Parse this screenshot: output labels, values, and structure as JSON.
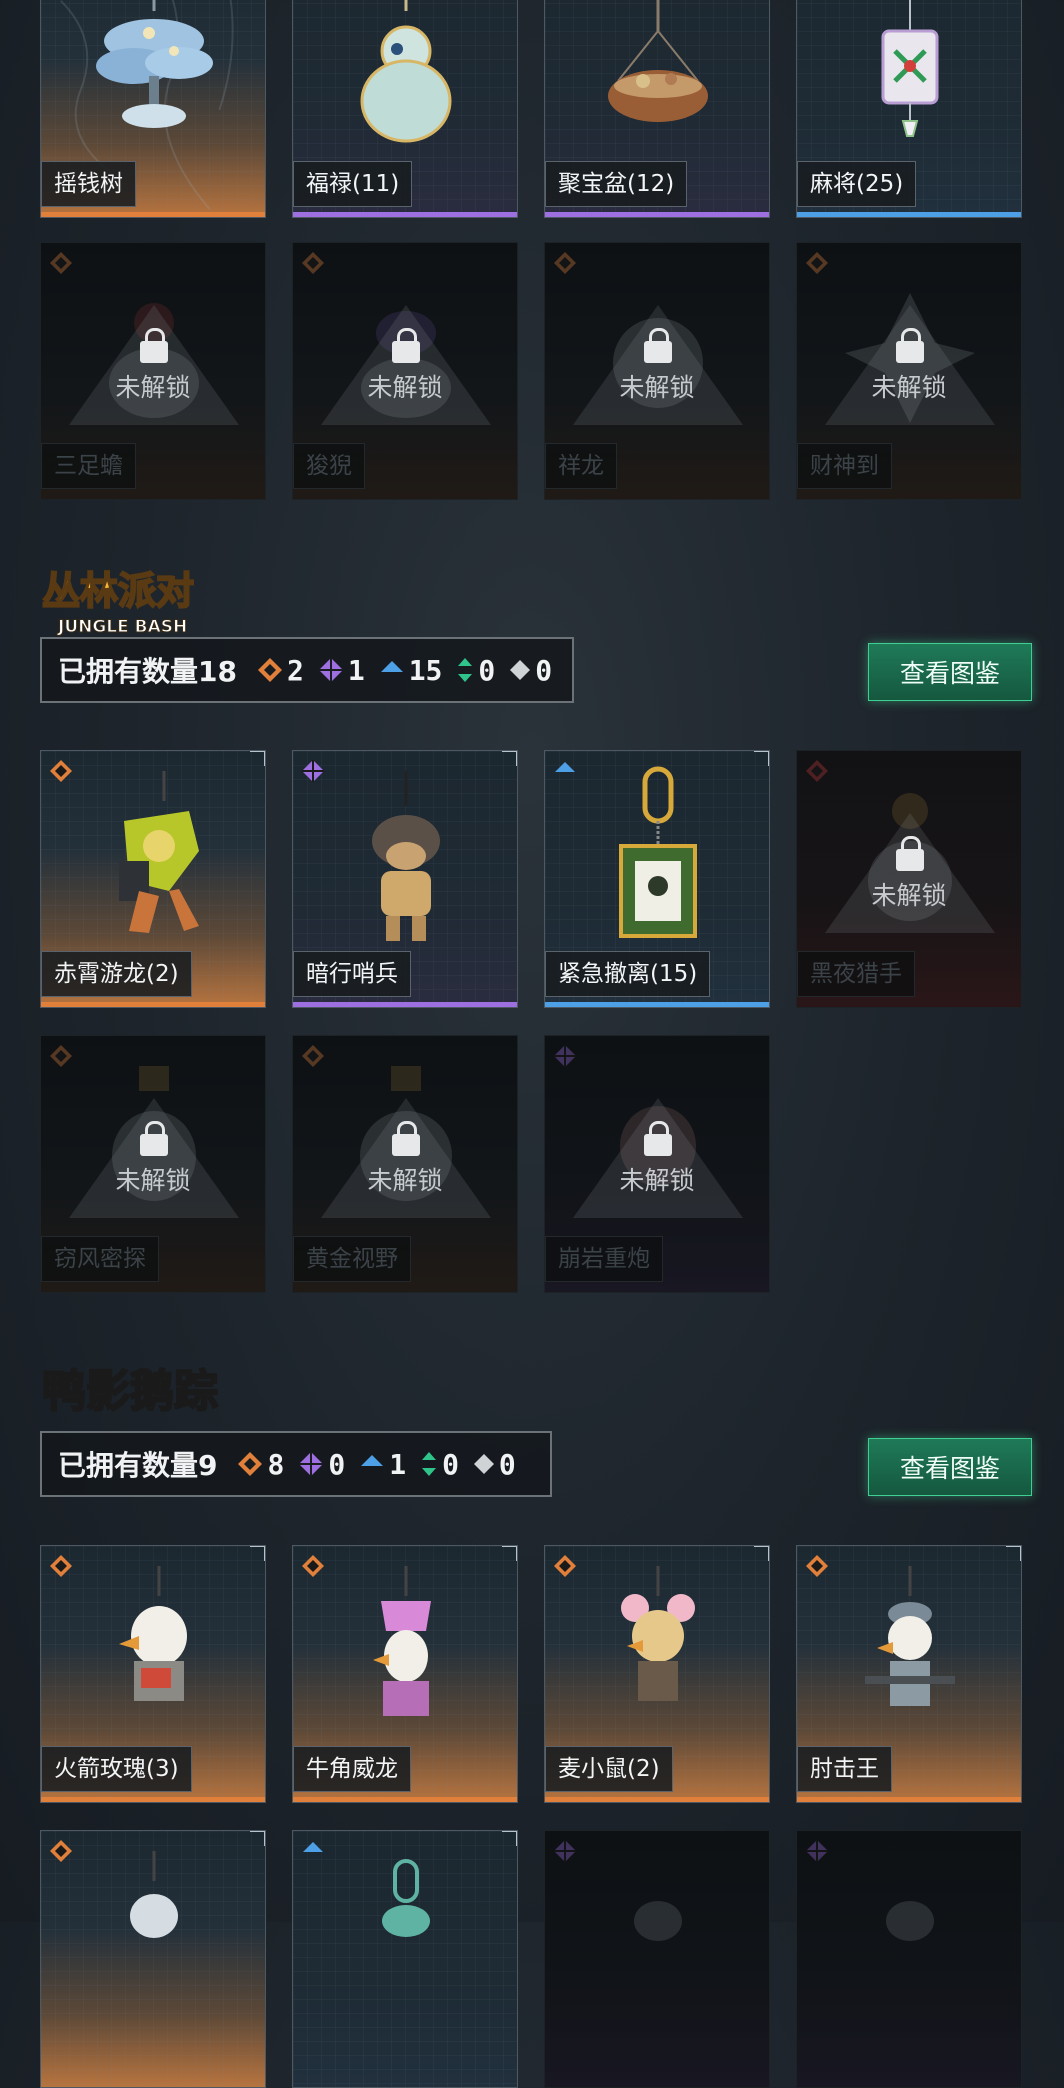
{
  "colors": {
    "orange": "#e0803a",
    "purple": "#9e6fe0",
    "blue": "#4d9fe6",
    "green": "#2fc48a",
    "white": "#cfd3d6",
    "button_green": "#1f7a58"
  },
  "rows": {
    "lucky_top": [
      {
        "name": "摇钱树",
        "rarity": "orange",
        "locked": false,
        "icon": "money-tree-charm"
      },
      {
        "name": "福禄(11)",
        "rarity": "purple",
        "locked": false,
        "icon": "gourd-charm"
      },
      {
        "name": "聚宝盆(12)",
        "rarity": "orange",
        "locked": false,
        "icon": "treasure-bowl-charm"
      },
      {
        "name": "麻将(25)",
        "rarity": "blue",
        "locked": false,
        "icon": "mahjong-charm"
      }
    ],
    "lucky_locked": [
      {
        "name": "三足蟾",
        "rarity": "orange",
        "locked": true,
        "lock_text": "未解锁"
      },
      {
        "name": "狻猊",
        "rarity": "orange",
        "locked": true,
        "lock_text": "未解锁"
      },
      {
        "name": "祥龙",
        "rarity": "orange",
        "locked": true,
        "lock_text": "未解锁"
      },
      {
        "name": "财神到",
        "rarity": "orange",
        "locked": true,
        "lock_text": "未解锁"
      }
    ]
  },
  "sections": [
    {
      "logo_text": "丛林派对",
      "logo_subtext": "JUNGLE BASH",
      "owned_label": "已拥有数量18",
      "stats": [
        {
          "rarity": "orange",
          "count": "2"
        },
        {
          "rarity": "purple",
          "count": "1"
        },
        {
          "rarity": "blue",
          "count": "15"
        },
        {
          "rarity": "green",
          "count": "0"
        },
        {
          "rarity": "white",
          "count": "0"
        }
      ],
      "view_button": "查看图鉴",
      "row1": [
        {
          "name": "赤霄游龙(2)",
          "rarity": "orange",
          "locked": false,
          "icon": "dragon-warrior-charm"
        },
        {
          "name": "暗行哨兵",
          "rarity": "purple",
          "locked": false,
          "icon": "sentinel-charm"
        },
        {
          "name": "紧急撤离(15)",
          "rarity": "blue",
          "locked": false,
          "icon": "emergency-tag-charm"
        },
        {
          "name": "黑夜猎手",
          "rarity": "red",
          "locked": true,
          "lock_text": "未解锁"
        }
      ],
      "row2": [
        {
          "name": "窃风密探",
          "rarity": "orange",
          "locked": true,
          "lock_text": "未解锁"
        },
        {
          "name": "黄金视野",
          "rarity": "orange",
          "locked": true,
          "lock_text": "未解锁"
        },
        {
          "name": "崩岩重炮",
          "rarity": "purple",
          "locked": true,
          "lock_text": "未解锁"
        }
      ]
    },
    {
      "logo_text": "鸭影鹅踪",
      "owned_label": "已拥有数量9",
      "stats": [
        {
          "rarity": "orange",
          "count": "8"
        },
        {
          "rarity": "purple",
          "count": "0"
        },
        {
          "rarity": "blue",
          "count": "1"
        },
        {
          "rarity": "green",
          "count": "0"
        },
        {
          "rarity": "white",
          "count": "0"
        }
      ],
      "view_button": "查看图鉴",
      "row1": [
        {
          "name": "火箭玫瑰(3)",
          "rarity": "orange",
          "locked": false,
          "icon": "duck-rocket-charm"
        },
        {
          "name": "牛角威龙",
          "rarity": "orange",
          "locked": false,
          "icon": "duck-horn-charm"
        },
        {
          "name": "麦小鼠(2)",
          "rarity": "orange",
          "locked": false,
          "icon": "duck-mouse-charm"
        },
        {
          "name": "肘击王",
          "rarity": "orange",
          "locked": false,
          "icon": "duck-soldier-charm"
        }
      ],
      "row2_partial": [
        {
          "rarity": "orange",
          "locked": false
        },
        {
          "rarity": "blue",
          "locked": false
        },
        {
          "rarity": "purple",
          "locked": true
        },
        {
          "rarity": "purple",
          "locked": true
        }
      ]
    }
  ]
}
